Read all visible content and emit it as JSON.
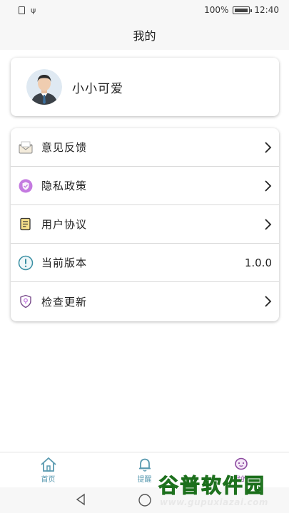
{
  "status_bar": {
    "battery_percent": "100%",
    "time": "12:40"
  },
  "header": {
    "title": "我的"
  },
  "profile": {
    "username": "小小可爱"
  },
  "menu": [
    {
      "label": "意见反馈",
      "icon": "envelope-icon"
    },
    {
      "label": "隐私政策",
      "icon": "shield-icon"
    },
    {
      "label": "用户协议",
      "icon": "document-icon"
    },
    {
      "label": "当前版本",
      "icon": "info-icon",
      "value": "1.0.0"
    },
    {
      "label": "检查更新",
      "icon": "location-shield-icon"
    }
  ],
  "tabs": [
    {
      "label": "首页",
      "icon": "home-icon"
    },
    {
      "label": "提醒",
      "icon": "bell-icon"
    },
    {
      "label": "我的",
      "icon": "profile-icon"
    }
  ],
  "watermark": {
    "brand": "谷普软件园",
    "url": "www.gupuxiazai.com"
  },
  "colors": {
    "accent": "#5a9ab0",
    "privacy_icon": "#c47ae0"
  }
}
